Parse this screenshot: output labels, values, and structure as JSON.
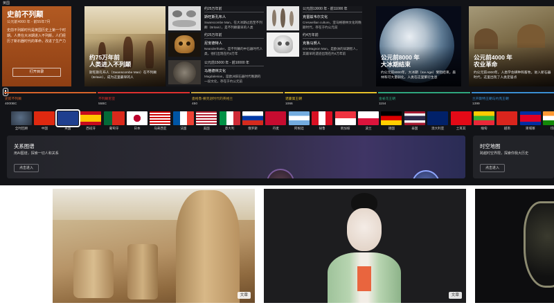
{
  "app": {
    "tag": "英国"
  },
  "hero": {
    "title": "史前不列颠",
    "range": "公元前4000 年 - 前55年7月",
    "desc": "史前不列颠时代是英国历史上第一个时期。人类在大冰期进入不列颠，人们经历了新石器时代的革命，改进了生产力",
    "button": "打开目录"
  },
  "panel1": {
    "title1": "约75万年前",
    "title2": "人类进入不列颠",
    "desc": "斯旺斯孔布人（Swanscombe Man）在不列颠（Britain），成为这里最早的人"
  },
  "midItems": [
    {
      "title": "约25万年前",
      "name": "斯旺斯孔布人",
      "desc": "Swanscombe Man，在大冰期过后至不列颠（Britain），是不列颠最早的人类"
    },
    {
      "title": "公元前13000 年 - 前11000 年",
      "name": "克雷兹韦尔文化",
      "desc": "Creswellian culture，亚马格德林文化的晚期时代，存在于约公元前"
    },
    {
      "title": "约25万年前",
      "name": "尼安德特人",
      "desc": "Neanderthaler，是不列颠的中石器时代人类，他们出现在约3万年"
    },
    {
      "title": "约4万年前",
      "name": "克鲁马努人",
      "desc": "Cro-Magnon Man，是欧洲的早期智人，其最早的遗迹出现在约4万年前"
    },
    {
      "title": "公元前15000 年 - 前10000 年",
      "name": "马格德林文化",
      "desc": "Magdalenian，是欧洲旧石器时代晚期的一段文化，存在于约公元前"
    }
  ],
  "panel3": {
    "title": "公元前8000 年",
    "subtitle": "大冰期结束",
    "desc": "约公元前8000年，大冰期（Ice Age）受阻结束，森林和可大量驯化，人类在这里繁衍生息"
  },
  "panel4": {
    "title": "公元前4000 年",
    "subtitle": "农业革命",
    "desc": "约公元前4000年，人类学会耕种和畜牧，进入新石器时代，这里出现了人类定居点"
  },
  "timeline": [
    {
      "name": "史前不列颠",
      "year": "4000BC",
      "color": "#d9642b"
    },
    {
      "name": "不列颠尼亚",
      "year": "55BC",
      "color": "#e0312f"
    },
    {
      "name": "盎格鲁-撒克逊时代的英格兰",
      "year": "450",
      "color": "#c8a43a"
    },
    {
      "name": "诺曼第王朝",
      "year": "1066",
      "color": "#e6c02a"
    },
    {
      "name": "金雀花王朝",
      "year": "1154",
      "color": "#2fa87f"
    },
    {
      "name": "兰开斯特王朝与约克王朝",
      "year": "1399",
      "color": "#3a8fd4"
    }
  ],
  "flags": [
    {
      "label": "全时回顾"
    },
    {
      "label": "中国"
    },
    {
      "label": "英国"
    },
    {
      "label": "西班牙"
    },
    {
      "label": "葡萄牙"
    },
    {
      "label": "日本"
    },
    {
      "label": "马来西亚"
    },
    {
      "label": "法国"
    },
    {
      "label": "美国"
    },
    {
      "label": "意大利"
    },
    {
      "label": "俄罗斯"
    },
    {
      "label": "丹麦"
    },
    {
      "label": "阿根廷"
    },
    {
      "label": "秘鲁"
    },
    {
      "label": "新加坡"
    },
    {
      "label": "波兰"
    },
    {
      "label": "德国"
    },
    {
      "label": "泰国"
    },
    {
      "label": "澳大利亚"
    },
    {
      "label": "土耳其"
    },
    {
      "label": "缅甸"
    },
    {
      "label": "越南"
    },
    {
      "label": "柬埔寨"
    },
    {
      "label": "印度"
    }
  ],
  "cards": {
    "relation": {
      "title": "关系图谱",
      "desc": "用AI图谱，探索一切人和关系",
      "button": "点击进入"
    },
    "map": {
      "title": "时空地图",
      "desc": "跨越时空界限，探索你我大历史",
      "button": "点击进入"
    }
  },
  "gallery": [
    {
      "badge": "文章"
    },
    {
      "badge": "文章"
    }
  ]
}
